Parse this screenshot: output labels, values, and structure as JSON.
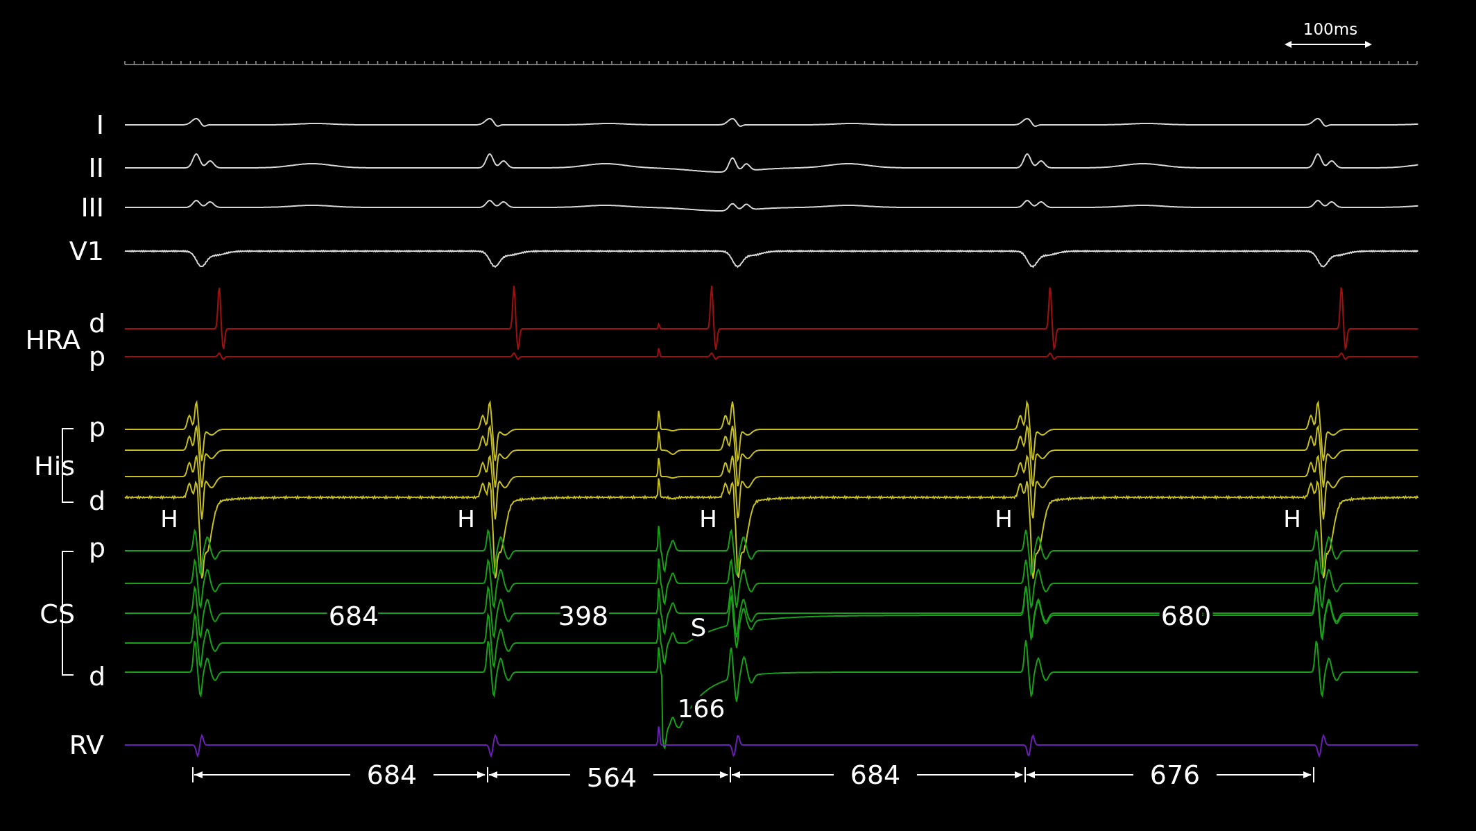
{
  "scale_bar": {
    "label": "100ms"
  },
  "surface_leads": [
    {
      "label": "I"
    },
    {
      "label": "II"
    },
    {
      "label": "III"
    },
    {
      "label": "V1"
    }
  ],
  "catheters": [
    {
      "label": "HRA",
      "kind": "hra",
      "color": "#a01010",
      "pole_labels": [
        "d",
        "p"
      ]
    },
    {
      "label": "His",
      "kind": "his",
      "color": "#c8c020",
      "pole_labels": [
        "p",
        "d"
      ]
    },
    {
      "label": "CS",
      "kind": "cs",
      "color": "#18a018",
      "pole_labels": [
        "p",
        "d"
      ]
    },
    {
      "label": "RV",
      "kind": "rv",
      "color": "#6a20b8"
    }
  ],
  "his_markers": [
    "H",
    "H",
    "H",
    "H",
    "H"
  ],
  "cs_intervals": [
    "684",
    "398",
    "680"
  ],
  "stimulus_label": "S",
  "coupling_interval": "166",
  "ventricular_intervals": [
    "684",
    "564",
    "684",
    "676"
  ]
}
